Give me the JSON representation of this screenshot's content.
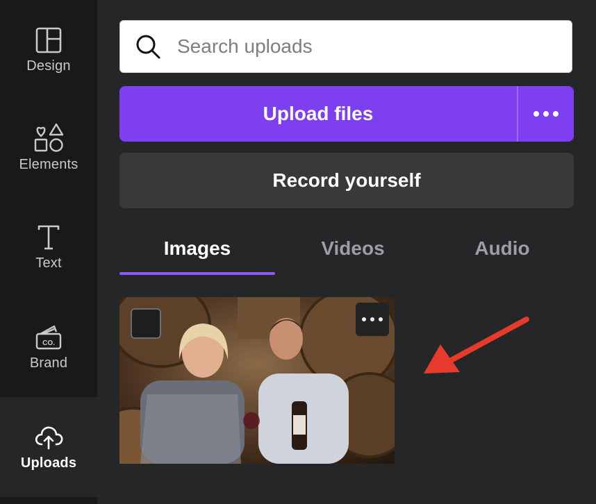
{
  "sidebar": {
    "items": [
      {
        "label": "Design",
        "icon": "layout-icon"
      },
      {
        "label": "Elements",
        "icon": "shapes-icon"
      },
      {
        "label": "Text",
        "icon": "text-icon"
      },
      {
        "label": "Brand",
        "icon": "brand-icon"
      },
      {
        "label": "Uploads",
        "icon": "cloud-upload-icon",
        "active": true
      }
    ]
  },
  "search": {
    "placeholder": "Search uploads",
    "value": ""
  },
  "upload": {
    "label": "Upload files",
    "more_icon": "more-dots-icon"
  },
  "record": {
    "label": "Record yourself"
  },
  "tabs": [
    {
      "label": "Images",
      "active": true
    },
    {
      "label": "Videos",
      "active": false
    },
    {
      "label": "Audio",
      "active": false
    }
  ],
  "colors": {
    "accent": "#7d3ff0",
    "tab_underline": "#8b5cf6",
    "annotation_arrow": "#e53a2c",
    "panel_bg": "#252627",
    "rail_bg": "#18191b"
  }
}
